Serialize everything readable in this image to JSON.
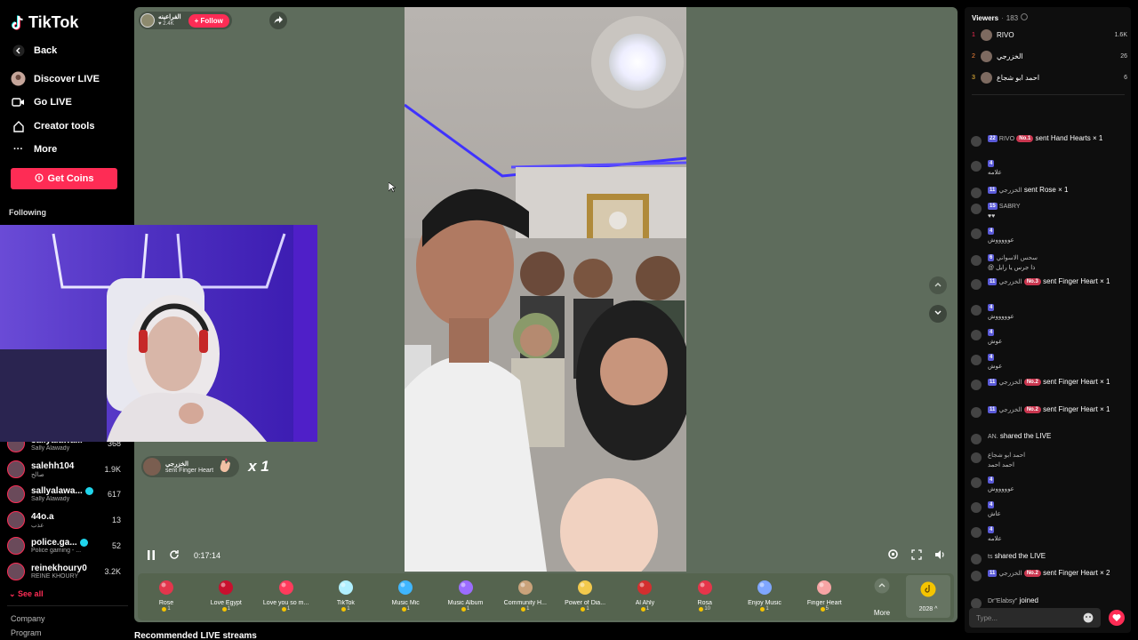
{
  "app": {
    "logo_text": "TikTok"
  },
  "sidebar": {
    "back": "Back",
    "nav": [
      {
        "label": "Discover LIVE",
        "icon": "avatar-icon"
      },
      {
        "label": "Go LIVE",
        "icon": "camera-icon"
      },
      {
        "label": "Creator tools",
        "icon": "home-icon"
      },
      {
        "label": "More",
        "icon": "more-icon"
      }
    ],
    "get_coins": "Get Coins",
    "following_label": "Following",
    "following": [
      {
        "name": "sallyalawa...",
        "sub": "Sally Alawady",
        "count": "368"
      },
      {
        "name": "salehh104",
        "sub": "صالح",
        "count": "1.9K"
      },
      {
        "name": "sallyalawa...",
        "sub": "Sally Alawady",
        "count": "617",
        "verified": true
      },
      {
        "name": "44o.a",
        "sub": "عذب",
        "count": "13"
      },
      {
        "name": "police.ga...",
        "sub": "Police gaming - ...",
        "count": "52",
        "verified": true
      },
      {
        "name": "reinekhoury0",
        "sub": "REINE KHOURY",
        "count": "3.2K"
      }
    ],
    "see_all": "See all",
    "footer": [
      "Company",
      "Program"
    ]
  },
  "player": {
    "host_name": "الفراعينه",
    "host_likes": "2.4K",
    "follow": "+ Follow",
    "gift_notice": {
      "name": "الخزرجي",
      "text": "sent Finger Heart",
      "multiplier": "x 1"
    },
    "time": "0:17:14"
  },
  "gifts": [
    {
      "name": "Rose",
      "price": "1",
      "color": "#e3364c"
    },
    {
      "name": "Love Egypt",
      "price": "1",
      "color": "#c8102e"
    },
    {
      "name": "Love you so m...",
      "price": "1",
      "color": "#ff3b5c"
    },
    {
      "name": "TikTok",
      "price": "1",
      "color": "#b0f0ff"
    },
    {
      "name": "Music Mic",
      "price": "1",
      "color": "#3fb6ff"
    },
    {
      "name": "Music Album",
      "price": "1",
      "color": "#9b6cff"
    },
    {
      "name": "Community H...",
      "price": "1",
      "color": "#c9a27a"
    },
    {
      "name": "Power of Dia...",
      "price": "1",
      "color": "#f2c94c"
    },
    {
      "name": "Al Ahly",
      "price": "1",
      "color": "#d32f2f"
    },
    {
      "name": "Rosa",
      "price": "10",
      "color": "#e5354a"
    },
    {
      "name": "Enjoy Music",
      "price": "1",
      "color": "#7fa6ff"
    },
    {
      "name": "Finger Heart",
      "price": "5",
      "color": "#f7a4a4"
    }
  ],
  "gift_more": "More",
  "coins": "2028",
  "recommended_title": "Recommended LIVE streams",
  "viewers": {
    "title": "Viewers",
    "count": "183",
    "top": [
      {
        "rank": "1",
        "name": "RIVO",
        "score": "1.6K"
      },
      {
        "rank": "2",
        "name": "الخزرجي",
        "score": "26"
      },
      {
        "rank": "3",
        "name": "احمد ابو شجاع",
        "score": "6"
      }
    ]
  },
  "chat": [
    {
      "lvl": "22",
      "name": "RIVO",
      "rank": "No.1",
      "text": "sent Hand Hearts × 1"
    },
    {
      "lvl": "4",
      "name": "",
      "text": "علامه"
    },
    {
      "lvl": "11",
      "name": "الخزرجي",
      "text": "sent Rose × 1"
    },
    {
      "lvl": "15",
      "name": "SABRY",
      "text": "♥♥"
    },
    {
      "lvl": "4",
      "name": "",
      "text": "عوووووش"
    },
    {
      "lvl": "6",
      "name": "سحس الاسواني",
      "text": "@ ذا جرس يا رايل"
    },
    {
      "lvl": "11",
      "name": "الخزرجي",
      "rank": "No.3",
      "text": "sent Finger Heart × 1"
    },
    {
      "lvl": "4",
      "name": "",
      "text": "عوووووش"
    },
    {
      "lvl": "4",
      "name": "",
      "text": "عوش"
    },
    {
      "lvl": "4",
      "name": "",
      "text": "عوش"
    },
    {
      "lvl": "11",
      "name": "الخزرجي",
      "rank": "No.2",
      "text": "sent Finger Heart × 1"
    },
    {
      "lvl": "11",
      "name": "الخزرجي",
      "rank": "No.2",
      "text": "sent Finger Heart × 1"
    },
    {
      "lvl": "",
      "name": "AN.",
      "text": "shared the LIVE"
    },
    {
      "lvl": "",
      "name": "احمد ابو شجاع",
      "text": "احمد احمد"
    },
    {
      "lvl": "4",
      "name": "",
      "text": "عوووووش"
    },
    {
      "lvl": "4",
      "name": "",
      "text": "عاش"
    },
    {
      "lvl": "4",
      "name": "",
      "text": "علامه"
    },
    {
      "lvl": "",
      "name": "ts",
      "text": "shared the LIVE"
    },
    {
      "lvl": "11",
      "name": "الخزرجي",
      "rank": "No.2",
      "text": "sent Finger Heart × 2"
    },
    {
      "lvl": "",
      "name": "Dr\"Elabsy\"",
      "text": "joined"
    }
  ],
  "chat_input_placeholder": "Type..."
}
